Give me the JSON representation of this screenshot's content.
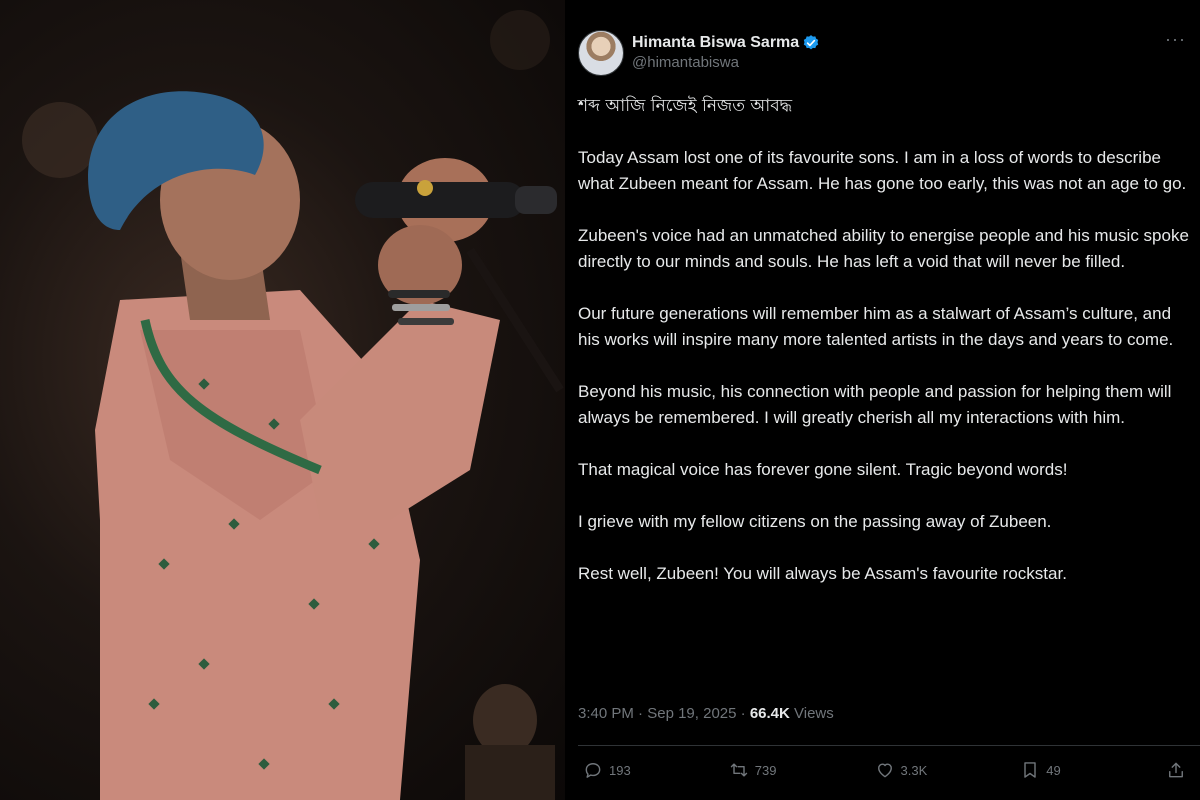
{
  "tweet": {
    "author": {
      "display_name": "Himanta Biswa Sarma",
      "handle": "@himantabiswa",
      "verified_icon": "verified-badge-icon"
    },
    "more_label": "···",
    "paragraphs": [
      "শব্দ আজি নিজেই নিজত আবদ্ধ",
      "Today Assam lost one of its favourite sons. I am in a loss of words to describe what Zubeen meant for Assam. He has gone too early, this was not an age to go.",
      "Zubeen's voice had an unmatched ability to energise people and his music spoke directly to our minds and souls. He has left a void that will never be filled.",
      "Our future generations will remember him as a stalwart of Assam’s culture, and his works will inspire many more talented artists in the days and years to come.",
      "Beyond his music, his connection with people and passion for helping them will always be remembered. I will greatly cherish all my interactions with him.",
      "That magical voice has forever gone silent. Tragic beyond words!",
      "I grieve with my fellow citizens on the passing away of Zubeen.",
      "Rest well, Zubeen! You will always be Assam's favourite rockstar."
    ],
    "meta": {
      "time": "3:40 PM",
      "separator": "·",
      "date": "Sep 19, 2025",
      "views_count": "66.4K",
      "views_label": "Views"
    },
    "actions": {
      "replies": "193",
      "reposts": "739",
      "likes": "3.3K",
      "bookmarks": "49"
    }
  },
  "colors": {
    "background": "#000000",
    "text": "#e7e9ea",
    "secondary_text": "#71767b",
    "verified": "#1d9bf0",
    "divider": "#2f3336"
  }
}
